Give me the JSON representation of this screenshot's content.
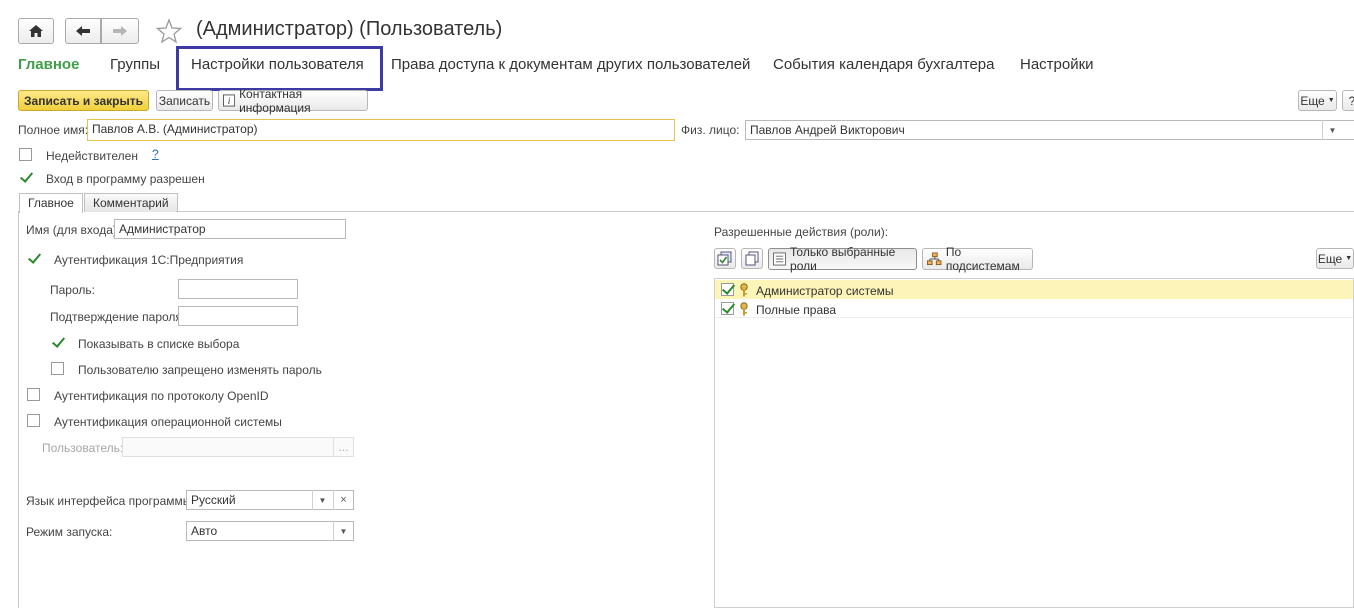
{
  "window": {
    "title": "(Администратор) (Пользователь)"
  },
  "nav_tabs": [
    {
      "label": "Главное"
    },
    {
      "label": "Группы"
    },
    {
      "label": "Настройки пользователя"
    },
    {
      "label": "Права доступа к документам других пользователей"
    },
    {
      "label": "События календаря бухгалтера"
    },
    {
      "label": "Настройки"
    }
  ],
  "toolbar": {
    "save_close": "Записать и закрыть",
    "save": "Записать",
    "contact_info": "Контактная информация",
    "more": "Еще"
  },
  "form": {
    "full_name_label": "Полное имя:",
    "full_name_value": "Павлов А.В. (Администратор)",
    "person_label": "Физ. лицо:",
    "person_value": "Павлов Андрей Викторович",
    "invalid_label": "Недействителен",
    "help_mark": "?",
    "login_allowed_label": "Вход в программу разрешен"
  },
  "inner_tabs": [
    {
      "label": "Главное"
    },
    {
      "label": "Комментарий"
    }
  ],
  "main_tab": {
    "login_name_label": "Имя (для входа):",
    "login_name_value": "Администратор",
    "auth_1c_label": "Аутентификация 1С:Предприятия",
    "password_label": "Пароль:",
    "password_confirm_label": "Подтверждение пароля:",
    "show_in_list_label": "Показывать в списке выбора",
    "no_change_password_label": "Пользователю запрещено изменять пароль",
    "openid_label": "Аутентификация по протоколу OpenID",
    "os_auth_label": "Аутентификация операционной системы",
    "os_user_label": "Пользователь:",
    "os_user_btn": "...",
    "language_label": "Язык интерфейса программы:",
    "language_value": "Русский",
    "launch_mode_label": "Режим запуска:",
    "launch_mode_value": "Авто"
  },
  "roles": {
    "header": "Разрешенные действия (роли):",
    "only_selected": "Только выбранные роли",
    "by_subsystems": "По подсистемам",
    "more": "Еще",
    "items": [
      {
        "label": "Администратор системы",
        "checked": true
      },
      {
        "label": "Полные права",
        "checked": true
      }
    ]
  },
  "colors": {
    "accent_green": "#3f9e4a",
    "highlight_border": "#3b3ba3",
    "yellow_button": "#f1cf3c",
    "selected_row": "#fdf4b8"
  },
  "icons": [
    "home-icon",
    "back-arrow-icon",
    "forward-arrow-icon",
    "star-icon",
    "info-icon",
    "check-all-icon",
    "copy-icon",
    "list-icon",
    "hierarchy-icon",
    "key-icon"
  ]
}
